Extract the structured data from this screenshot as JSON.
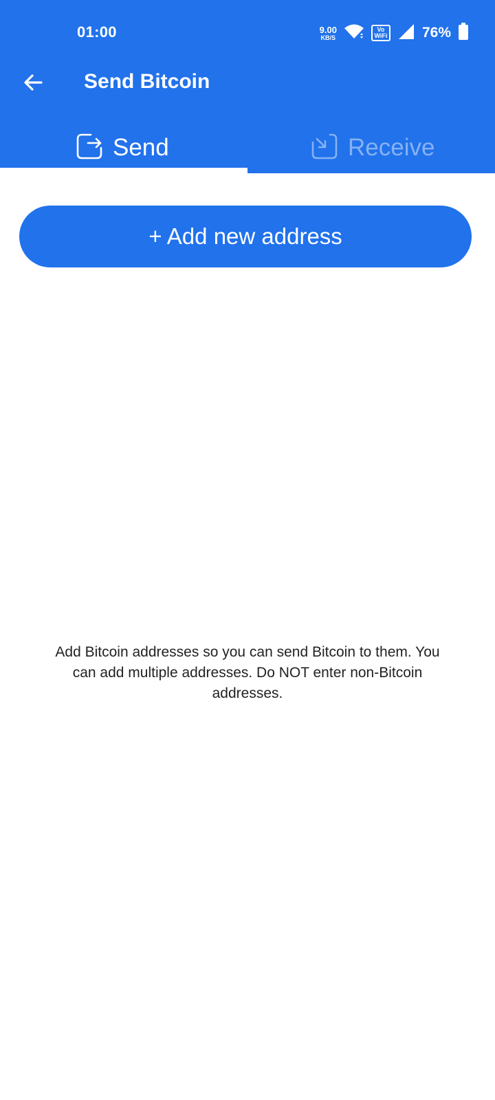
{
  "status_bar": {
    "time": "01:00",
    "net_speed_value": "9.00",
    "net_speed_unit": "KB/S",
    "vowifi_top": "Vo",
    "vowifi_bottom": "WiFi",
    "battery_percent": "76%",
    "icons": [
      "wifi-icon",
      "signal-icon",
      "battery-icon"
    ]
  },
  "app_bar": {
    "title": "Send Bitcoin",
    "back_icon": "arrow-left-icon"
  },
  "tabs": [
    {
      "label": "Send",
      "icon": "send-out-icon",
      "active": true
    },
    {
      "label": "Receive",
      "icon": "receive-in-icon",
      "active": false
    }
  ],
  "main": {
    "add_button_label": "+ Add new address",
    "info_text": "Add Bitcoin addresses so you can send Bitcoin to them. You can add multiple addresses. Do NOT enter non-Bitcoin addresses."
  },
  "colors": {
    "primary": "#2172eb",
    "background": "#ffffff",
    "text": "#222222",
    "inactive_tab": "rgba(255,255,255,0.45)"
  }
}
